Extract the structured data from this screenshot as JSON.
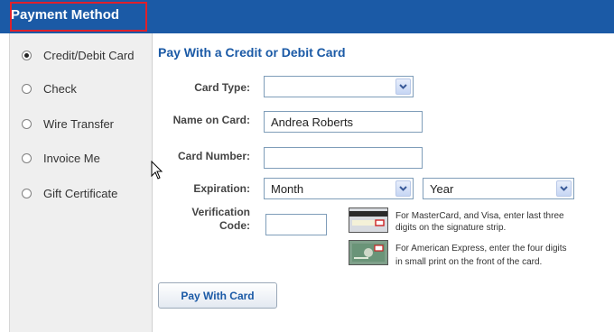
{
  "header": {
    "title": "Payment Method"
  },
  "sidebar": {
    "items": [
      {
        "label": "Credit/Debit Card",
        "checked": true
      },
      {
        "label": "Check",
        "checked": false
      },
      {
        "label": "Wire Transfer",
        "checked": false
      },
      {
        "label": "Invoice Me",
        "checked": false
      },
      {
        "label": "Gift Certificate",
        "checked": false
      }
    ]
  },
  "form": {
    "title": "Pay With a Credit or Debit Card",
    "card_type_label": "Card Type:",
    "card_type_value": "",
    "name_label": "Name on Card:",
    "name_value": "Andrea  Roberts",
    "number_label": "Card Number:",
    "number_value": "",
    "expiration_label": "Expiration:",
    "month_value": "Month",
    "year_value": "Year",
    "verification_label_1": "Verification",
    "verification_label_2": "Code:",
    "verification_value": "",
    "mc_note_1": "For MasterCard, and Visa, enter last three",
    "mc_note_2": "digits on the signature strip.",
    "amex_note_1": "For American Express, enter the four digits",
    "amex_note_2": "in small print on the front of the card.",
    "submit_label": "Pay With Card"
  },
  "colors": {
    "header_bg": "#1b5aa6",
    "title_blue": "#1b5aa6",
    "highlight": "#e0202a"
  }
}
